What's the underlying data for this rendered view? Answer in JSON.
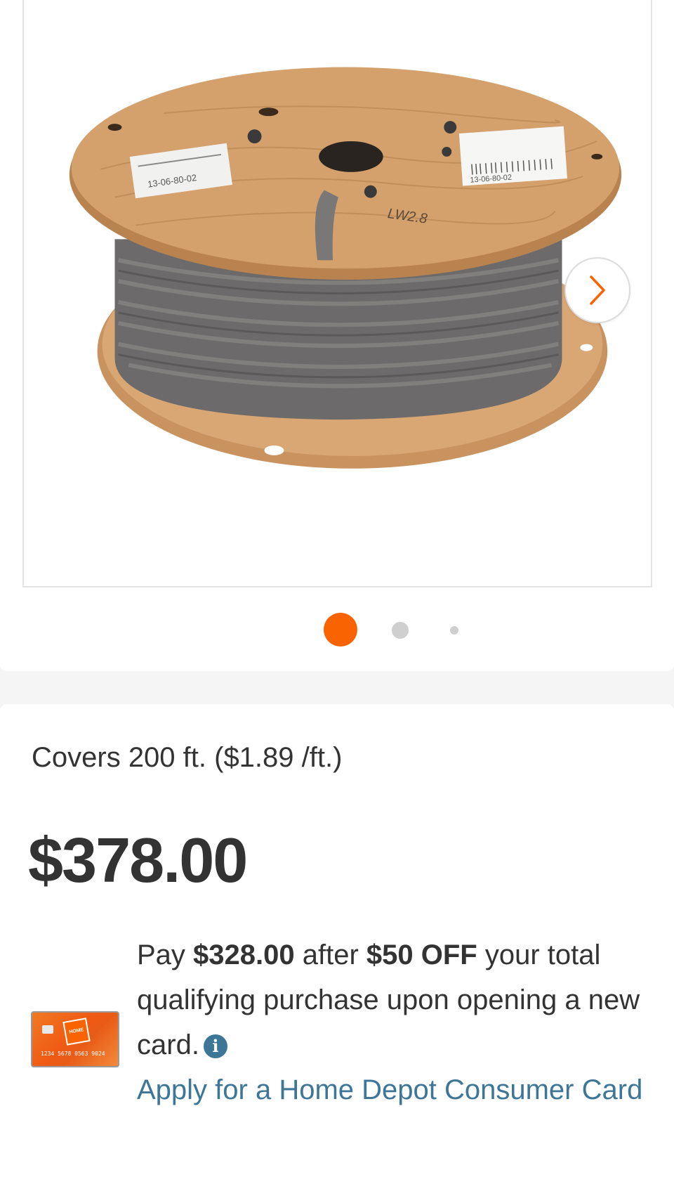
{
  "gallery": {
    "image_alt": "Gray electrical cable on wooden spool",
    "next_icon": "chevron-right-icon",
    "dots": 3,
    "active_dot": 1,
    "accent": "#f96302",
    "spool_label_left": "13-06-80-02",
    "spool_label_right": "13-06-80-02",
    "spool_stencil": "LW2.8"
  },
  "pricing": {
    "coverage": "Covers 200 ft. ($1.89 /ft.)",
    "price": "$378.00"
  },
  "card_offer": {
    "card_icon": "home-depot-credit-card",
    "card_number": "1234 5678 0563 9024",
    "card_logo": "THE HOME DEPOT",
    "text_pay": "Pay ",
    "amount": "$328.00",
    "text_after": " after ",
    "discount": "$50 OFF",
    "text_rest": " your total qualifying purchase upon opening a new card.",
    "info_icon": "info-icon",
    "apply_link": "Apply for a Home Depot Consumer Card",
    "link_color": "#3e7697"
  }
}
